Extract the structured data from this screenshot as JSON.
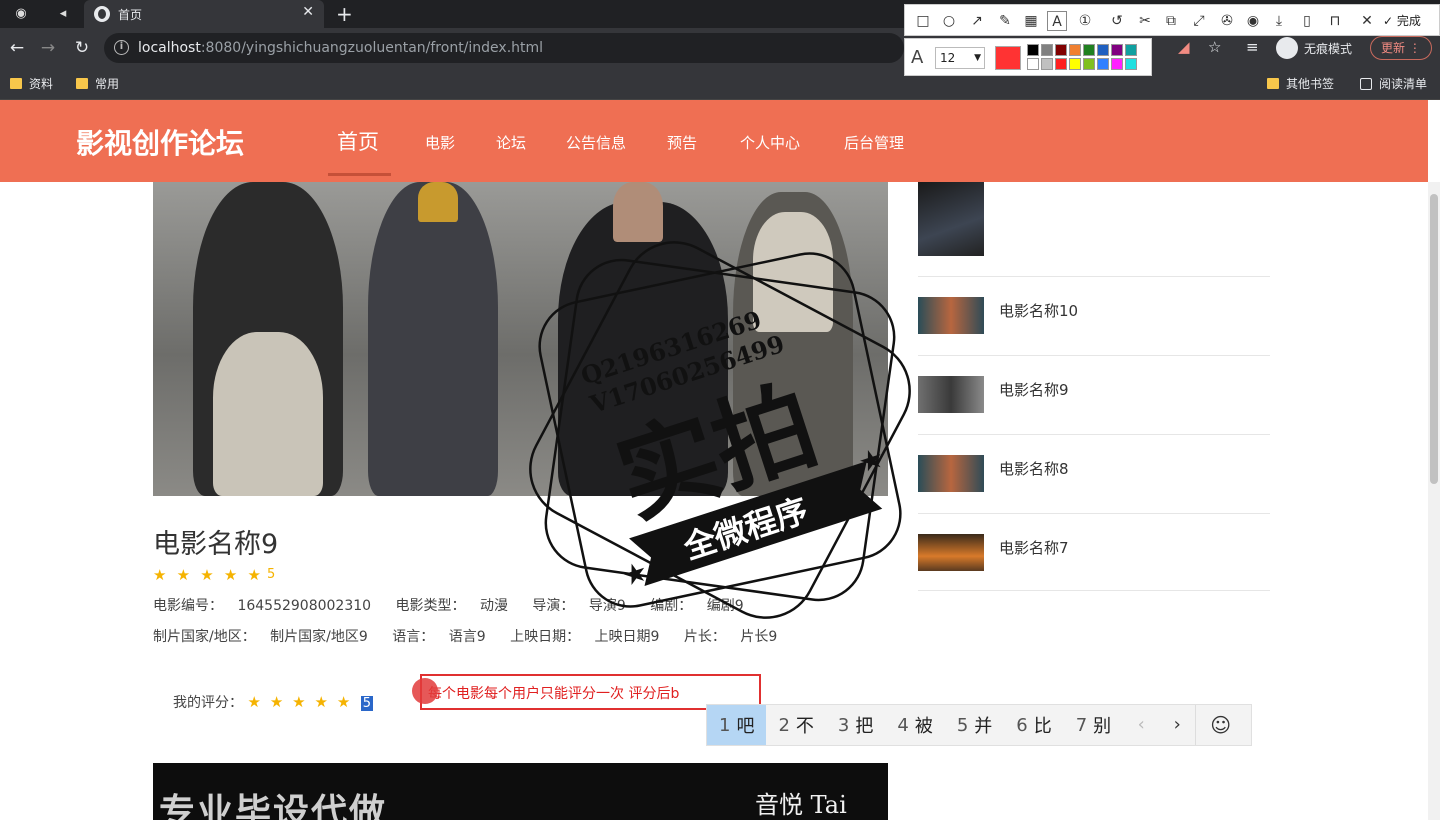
{
  "browser": {
    "tab_title": "首页",
    "url_host": "localhost",
    "url_rest": ":8080/yingshichuangzuoluentan/front/index.html",
    "incognito_label": "无痕模式",
    "update_label": "更新",
    "bookmarks": [
      "资料",
      "常用"
    ],
    "bookmarks_right": [
      "其他书签",
      "阅读清单"
    ]
  },
  "annotation_tool": {
    "done_label": "完成",
    "font_size": "12",
    "current_color": "#ff3333",
    "palette": [
      "#000000",
      "#808080",
      "#800000",
      "#f08030",
      "#208020",
      "#2060c0",
      "#800080",
      "#10a0a0",
      "#ffffff",
      "#c0c0c0",
      "#ff2020",
      "#ffff00",
      "#80c020",
      "#3080ff",
      "#ff20ff",
      "#20e0e0"
    ]
  },
  "site": {
    "title": "影视创作论坛",
    "nav": [
      "首页",
      "电影",
      "论坛",
      "公告信息",
      "预告",
      "个人中心",
      "后台管理"
    ],
    "active_nav": "首页",
    "brand_color": "#ef6f53"
  },
  "movie": {
    "title": "电影名称9",
    "rating": "5",
    "star_count": 5,
    "id_label": "电影编号：",
    "id_value": "164552908002310",
    "type_label": "电影类型：",
    "type_value": "动漫",
    "director_label": "导演：",
    "director_value": "导演9",
    "writer_label": "编剧：",
    "writer_value": "编剧9",
    "country_label": "制片国家/地区：",
    "country_value": "制片国家/地区9",
    "language_label": "语言：",
    "language_value": "语言9",
    "release_label": "上映日期：",
    "release_value": "上映日期9",
    "length_label": "片长：",
    "length_value": "片长9"
  },
  "my_rating": {
    "label": "我的评分：",
    "value": "5"
  },
  "note": {
    "text": "每个电影每个用户只能评分一次 评分后b"
  },
  "ime": {
    "candidates": [
      {
        "n": "1",
        "t": "吧"
      },
      {
        "n": "2",
        "t": "不"
      },
      {
        "n": "3",
        "t": "把"
      },
      {
        "n": "4",
        "t": "被"
      },
      {
        "n": "5",
        "t": "并"
      },
      {
        "n": "6",
        "t": "比"
      },
      {
        "n": "7",
        "t": "别"
      }
    ]
  },
  "banner": {
    "left_text": "专业毕设代做",
    "right_text": "音悦 Tai"
  },
  "sidebar": [
    {
      "name": ""
    },
    {
      "name": "电影名称10"
    },
    {
      "name": "电影名称9"
    },
    {
      "name": "电影名称8"
    },
    {
      "name": "电影名称7"
    }
  ],
  "watermark": {
    "line1": "Q2196316269",
    "line2": "V17060256499",
    "main": "实拍",
    "ribbon": "全微程序"
  }
}
